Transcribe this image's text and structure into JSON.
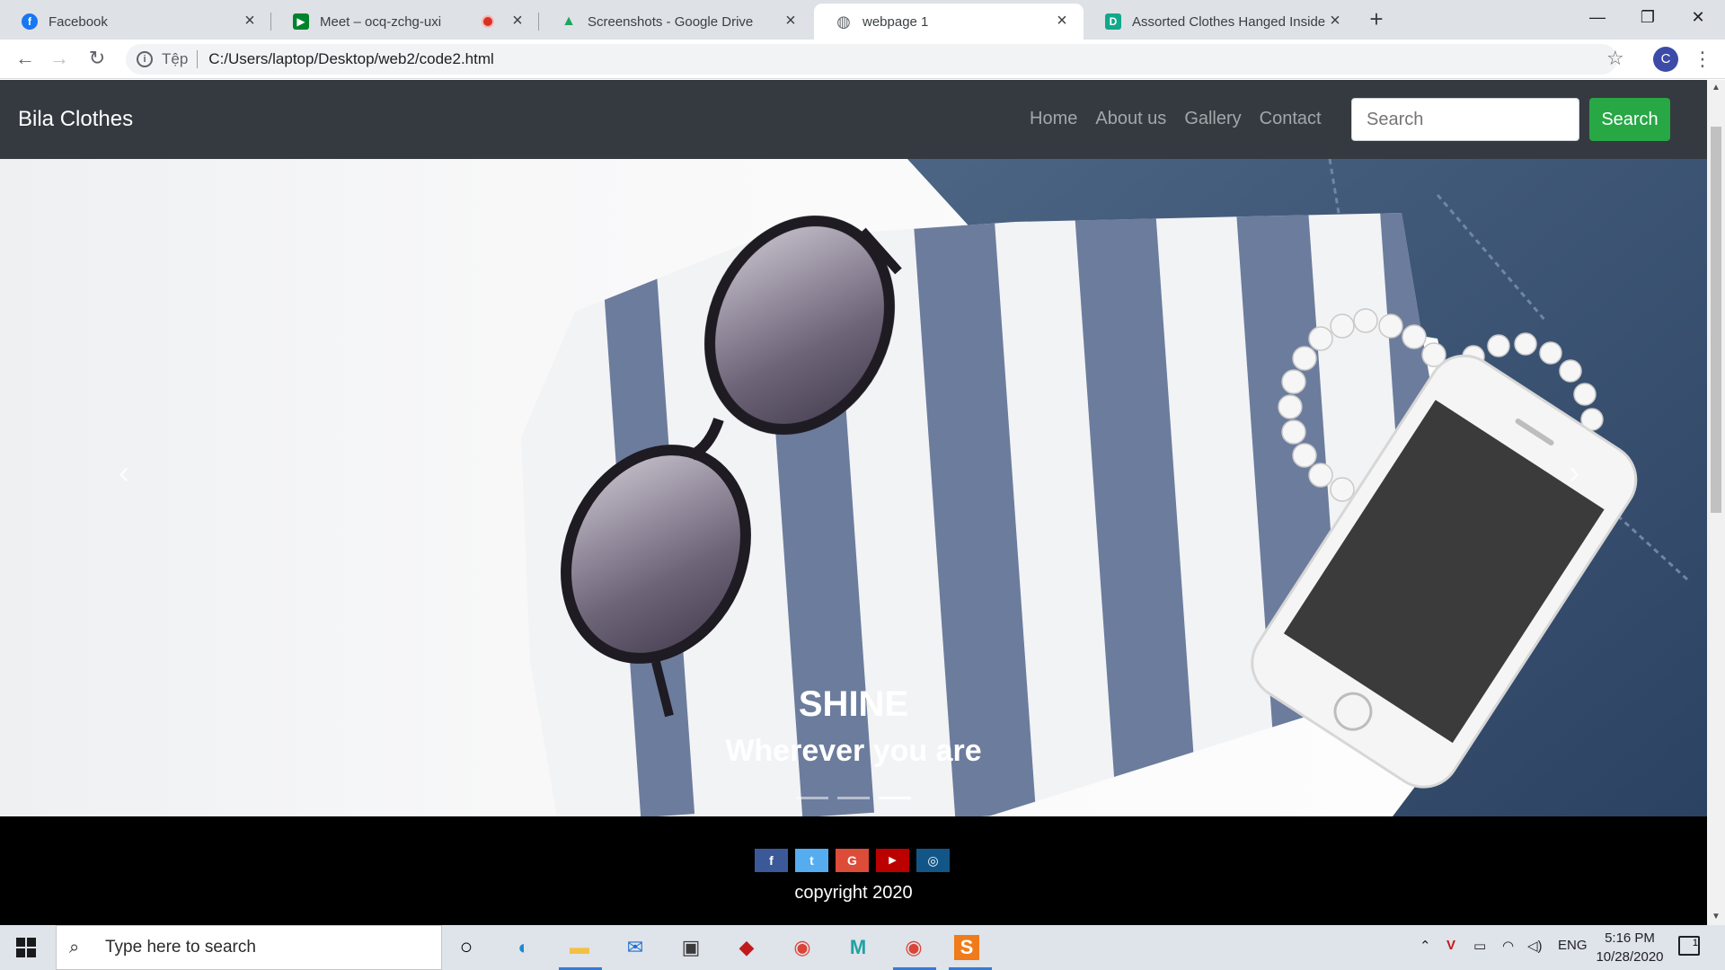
{
  "browser": {
    "tabs": [
      {
        "title": "Facebook",
        "icon": "facebook-icon",
        "color": "#1877f2",
        "glyph": "f"
      },
      {
        "title": "Meet – ocq-zchg-uxi",
        "icon": "google-meet-icon",
        "color": "#00832d",
        "glyph": "▶",
        "recording": true
      },
      {
        "title": "Screenshots - Google Drive",
        "icon": "google-drive-icon",
        "color": "#1fa463",
        "glyph": "▲"
      },
      {
        "title": "webpage 1",
        "icon": "globe-icon",
        "color": "#5f6368",
        "glyph": "◍",
        "active": true
      },
      {
        "title": "Assorted Clothes Hanged Inside Clothing Store",
        "icon": "doc-icon",
        "color": "#12a88a",
        "glyph": "D"
      }
    ],
    "new_tab": "+",
    "window_controls": {
      "minimize": "—",
      "restore": "❐",
      "close": "✕"
    },
    "address": {
      "scheme_label": "Tệp",
      "url": "C:/Users/laptop/Desktop/web2/code2.html"
    },
    "profile_initial": "C"
  },
  "page": {
    "brand": "Bila Clothes",
    "nav": [
      "Home",
      "About us",
      "Gallery",
      "Contact"
    ],
    "search": {
      "placeholder": "Search",
      "button": "Search"
    },
    "carousel": {
      "title": "SHINE",
      "subtitle": "Wherever you are",
      "prev": "‹",
      "next": "›",
      "slides": 3,
      "active_slide": 3
    },
    "footer": {
      "socials": [
        {
          "name": "facebook",
          "glyph": "f",
          "color": "#3b5998"
        },
        {
          "name": "twitter",
          "glyph": "t",
          "color": "#55acee"
        },
        {
          "name": "google",
          "glyph": "G",
          "color": "#dd4b39"
        },
        {
          "name": "youtube",
          "glyph": "▶",
          "color": "#bb0000"
        },
        {
          "name": "instagram",
          "glyph": "◎",
          "color": "#125688"
        }
      ],
      "copyright": "copyright 2020"
    }
  },
  "taskbar": {
    "search_placeholder": "Type here to search",
    "language": "ENG",
    "time": "5:16 PM",
    "date": "10/28/2020",
    "notification_count": "1"
  }
}
